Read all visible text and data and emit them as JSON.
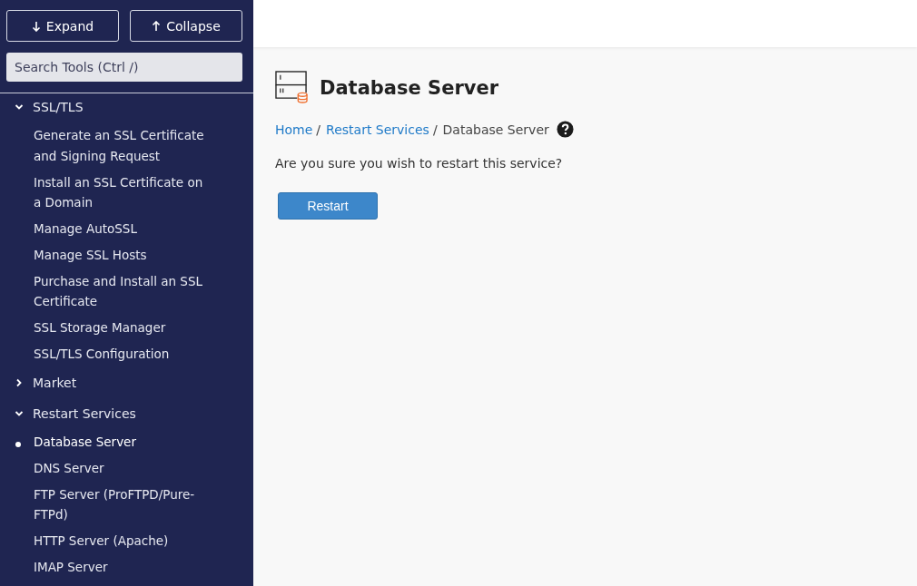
{
  "sidebar": {
    "buttons": [
      {
        "kind": "expand",
        "label": "Expand"
      },
      {
        "kind": "collapse",
        "label": "Collapse"
      }
    ],
    "search": {
      "placeholder": "Search Tools (Ctrl /)"
    },
    "tree": [
      {
        "label": "SSL/TLS",
        "expanded": true,
        "children": [
          {
            "label": "Generate an SSL Certificate and Signing Request",
            "selected": false
          },
          {
            "label": "Install an SSL Certificate on a Domain",
            "selected": false
          },
          {
            "label": "Manage AutoSSL",
            "selected": false
          },
          {
            "label": "Manage SSL Hosts",
            "selected": false
          },
          {
            "label": "Purchase and Install an SSL Certificate",
            "selected": false
          },
          {
            "label": "SSL Storage Manager",
            "selected": false
          },
          {
            "label": "SSL/TLS Configuration",
            "selected": false
          }
        ]
      },
      {
        "label": "Market",
        "expanded": false
      },
      {
        "label": "Restart Services",
        "expanded": true,
        "children": [
          {
            "label": "Database Server",
            "selected": true
          },
          {
            "label": "DNS Server",
            "selected": false
          },
          {
            "label": "FTP Server (ProFTPD/Pure-FTPd)",
            "selected": false
          },
          {
            "label": "HTTP Server (Apache)",
            "selected": false
          },
          {
            "label": "IMAP Server",
            "selected": false
          }
        ]
      }
    ]
  },
  "page": {
    "title": "Database Server",
    "breadcrumb": [
      {
        "label": "Home",
        "link": true
      },
      {
        "label": "Restart Services",
        "link": true
      },
      {
        "label": "Database Server",
        "link": false
      }
    ],
    "separator": "/",
    "message": "Are you sure you wish to restart this service?",
    "button": "Restart"
  }
}
